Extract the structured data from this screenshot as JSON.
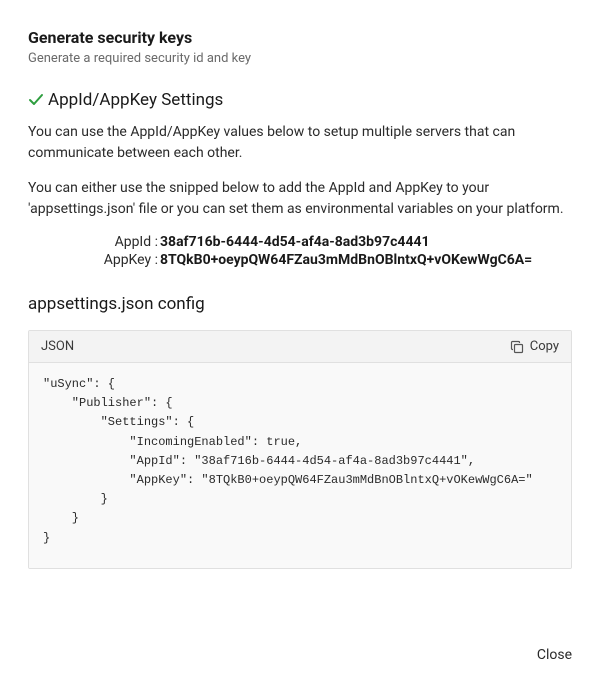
{
  "header": {
    "title": "Generate security keys",
    "subtitle": "Generate a required security id and key"
  },
  "section": {
    "heading": "AppId/AppKey Settings",
    "paragraph1": "You can use the AppId/AppKey values below to setup multiple servers that can communicate between each other.",
    "paragraph2": "You can either use the snipped below to add the AppId and AppKey to your 'appsettings.json' file or you can set them as environmental variables on your platform."
  },
  "keys": {
    "appid_label": "AppId :",
    "appid_value": "38af716b-6444-4d54-af4a-8ad3b97c4441",
    "appkey_label": "AppKey :",
    "appkey_value": "8TQkB0+oeypQW64FZau3mMdBnOBlntxQ+vOKewWgC6A="
  },
  "config": {
    "heading": "appsettings.json config",
    "language_label": "JSON",
    "copy_label": "Copy",
    "code": "\"uSync\": {\n    \"Publisher\": {\n        \"Settings\": {\n            \"IncomingEnabled\": true,\n            \"AppId\": \"38af716b-6444-4d54-af4a-8ad3b97c4441\",\n            \"AppKey\": \"8TQkB0+oeypQW64FZau3mMdBnOBlntxQ+vOKewWgC6A=\"\n        }\n    }\n}"
  },
  "footer": {
    "close_label": "Close"
  }
}
